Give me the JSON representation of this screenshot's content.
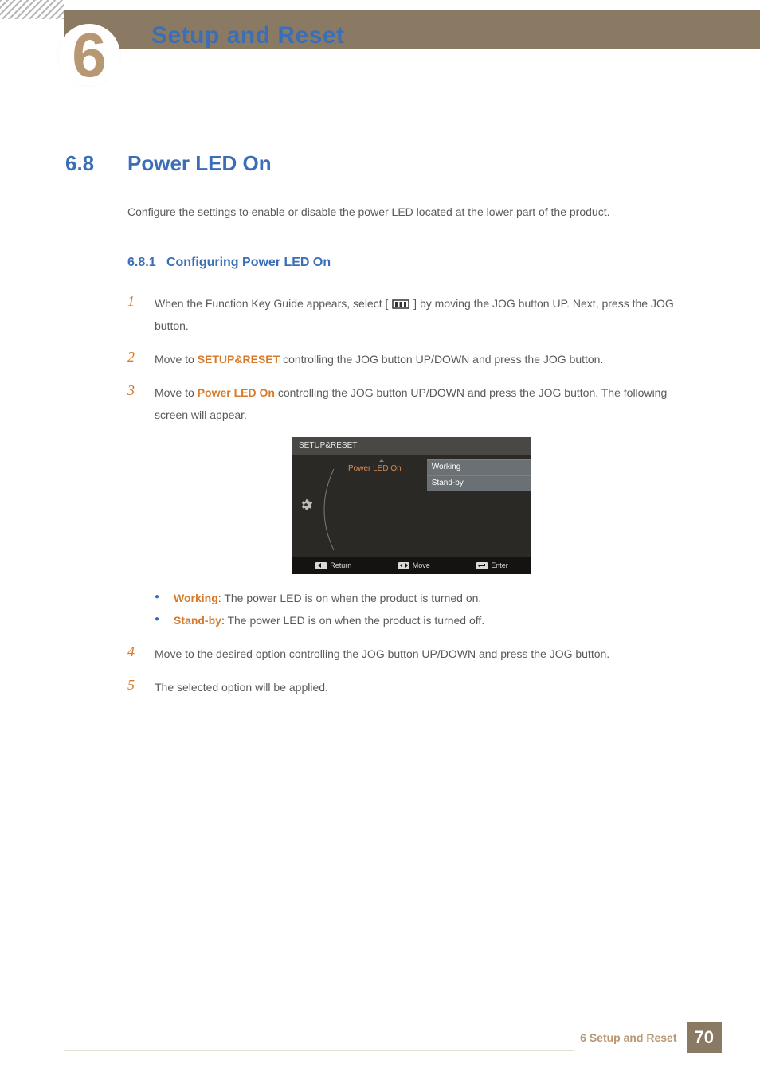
{
  "chapter": {
    "number": "6",
    "title": "Setup and Reset"
  },
  "section": {
    "number": "6.8",
    "title": "Power LED On",
    "intro": "Configure the settings to enable or disable the power LED located at the lower part of the product."
  },
  "subsection": {
    "number": "6.8.1",
    "title": "Configuring Power LED On"
  },
  "steps": {
    "s1": {
      "num": "1",
      "pre": "When the Function Key Guide appears, select  [",
      "post": "]  by moving the JOG button UP. Next, press the JOG button."
    },
    "s2": {
      "num": "2",
      "pre": "Move to ",
      "bold": "SETUP&RESET",
      "post": " controlling the JOG button UP/DOWN and press the JOG button."
    },
    "s3": {
      "num": "3",
      "pre": "Move to ",
      "bold": "Power LED On",
      "post": " controlling the JOG button UP/DOWN and press the JOG button. The following screen will appear."
    },
    "s4": {
      "num": "4",
      "text": "Move to the desired option controlling the JOG button UP/DOWN and press the JOG button."
    },
    "s5": {
      "num": "5",
      "text": "The selected option will be applied."
    }
  },
  "osd": {
    "title": "SETUP&RESET",
    "label": "Power LED On",
    "option1": "Working",
    "option2": "Stand-by",
    "footer": {
      "return": "Return",
      "move": "Move",
      "enter": "Enter"
    }
  },
  "bullets": {
    "b1": {
      "bold": "Working",
      "text": ": The power LED is on when the product is turned on."
    },
    "b2": {
      "bold": "Stand-by",
      "text": ": The power LED is on when the product is turned off."
    }
  },
  "footer": {
    "label": "6 Setup and Reset",
    "page": "70"
  }
}
